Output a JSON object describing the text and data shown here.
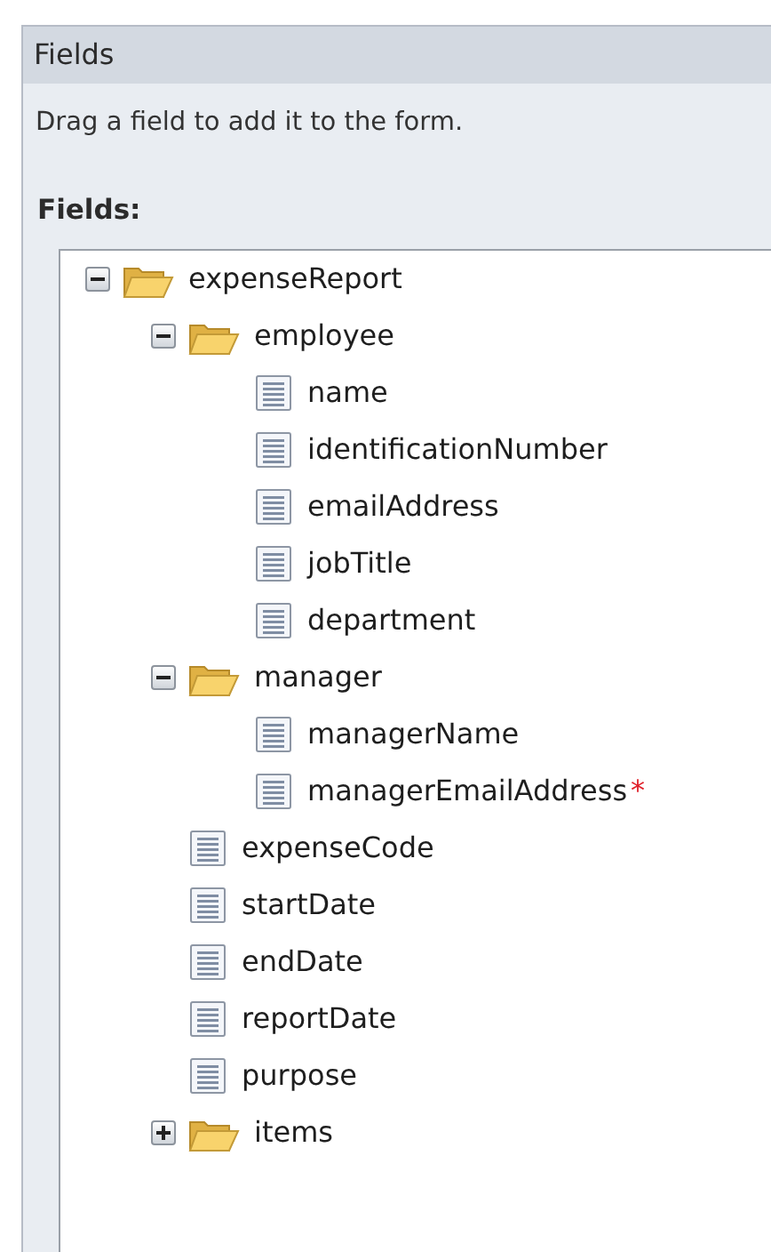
{
  "panel": {
    "title": "Fields",
    "instruction": "Drag a field to add it to the form.",
    "list_label": "Fields:"
  },
  "tree": [
    {
      "kind": "folder",
      "label": "expenseReport",
      "expanded": true,
      "children": [
        {
          "kind": "folder",
          "label": "employee",
          "expanded": true,
          "children": [
            {
              "kind": "field",
              "label": "name"
            },
            {
              "kind": "field",
              "label": "identificationNumber"
            },
            {
              "kind": "field",
              "label": "emailAddress"
            },
            {
              "kind": "field",
              "label": "jobTitle"
            },
            {
              "kind": "field",
              "label": "department"
            }
          ]
        },
        {
          "kind": "folder",
          "label": "manager",
          "expanded": true,
          "children": [
            {
              "kind": "field",
              "label": "managerName"
            },
            {
              "kind": "field",
              "label": "managerEmailAddress",
              "required_mark": "*"
            }
          ]
        },
        {
          "kind": "field",
          "label": "expenseCode"
        },
        {
          "kind": "field",
          "label": "startDate"
        },
        {
          "kind": "field",
          "label": "endDate"
        },
        {
          "kind": "field",
          "label": "reportDate"
        },
        {
          "kind": "field",
          "label": "purpose"
        },
        {
          "kind": "folder",
          "label": "items",
          "expanded": false
        }
      ]
    }
  ]
}
